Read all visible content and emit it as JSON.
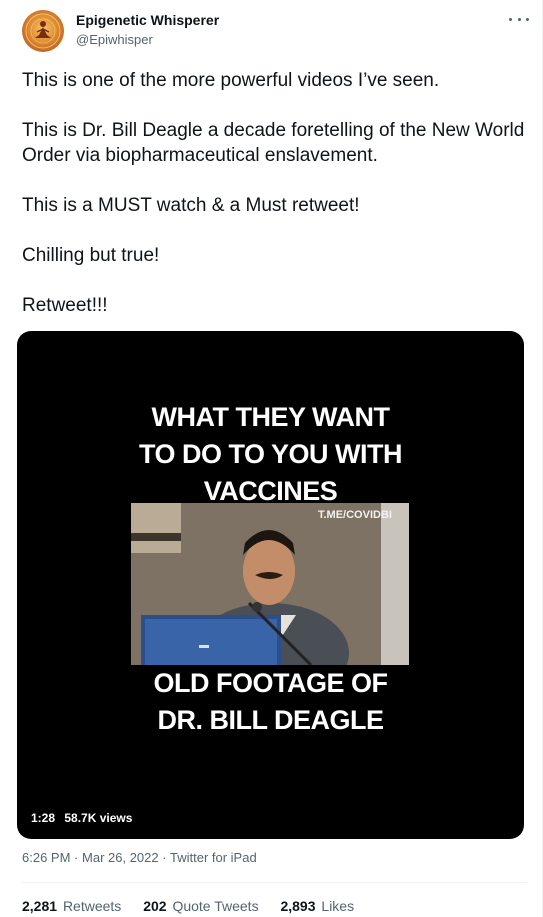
{
  "author": {
    "name": "Epigenetic Whisperer",
    "handle": "@Epiwhisper",
    "avatar_icon": "meditating-figure-icon"
  },
  "menu": {
    "icon": "more-options-icon"
  },
  "tweet": {
    "paragraphs": [
      "This is one of the more powerful videos I’ve seen.",
      "This is Dr. Bill Deagle a decade foretelling of the New World Order via biopharmaceutical enslavement.",
      "This is a MUST watch & a Must retweet!",
      "Chilling but true!",
      "Retweet!!!"
    ]
  },
  "video": {
    "caption_top": [
      "WHAT THEY WANT",
      "TO DO TO YOU WITH",
      "VACCINES"
    ],
    "watermark": "T.ME/COVIDBI",
    "caption_bottom": [
      "OLD FOOTAGE OF",
      "DR. BILL DEAGLE"
    ],
    "duration": "1:28",
    "views": "58.7K views"
  },
  "meta": {
    "time": "6:26 PM",
    "separator": "·",
    "date": "Mar 26, 2022",
    "source": "Twitter for iPad"
  },
  "stats": {
    "retweets_count": "2,281",
    "retweets_label": "Retweets",
    "quotes_count": "202",
    "quotes_label": "Quote Tweets",
    "likes_count": "2,893",
    "likes_label": "Likes"
  },
  "colors": {
    "text_primary": "#0f1419",
    "text_secondary": "#536471",
    "media_bg": "#000000"
  }
}
